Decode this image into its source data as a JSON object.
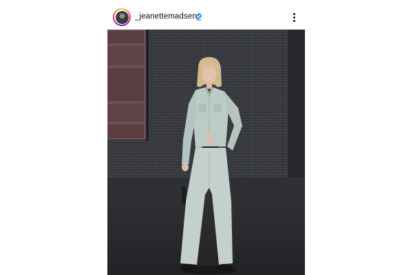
{
  "post": {
    "username": "_jeanettemadsen_",
    "verified": true,
    "avatar_icon": "profile-avatar",
    "more_icon": "more-options-icon",
    "image": {
      "subject": "person",
      "outfit_color": "#b9c8c4",
      "wall_color": "#3c3f44",
      "ground_color": "#2d2d30"
    }
  },
  "colors": {
    "verified_badge": "#3897f0",
    "text": "#111111",
    "story_ring": [
      "#f9ce34",
      "#ee2a7b",
      "#6228d7"
    ]
  }
}
